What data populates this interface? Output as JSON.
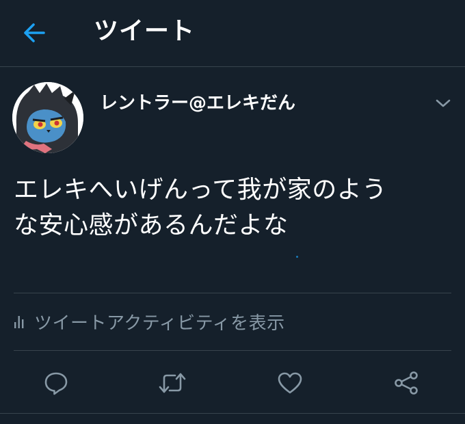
{
  "header": {
    "title": "ツイート",
    "back_icon": "arrow-left-icon"
  },
  "tweet": {
    "display_name": "レントラー@エレキだん",
    "text": "エレキへいげんって我が家のよう\nな安心感があるんだよな",
    "avatar_icon": "luxray-avatar",
    "menu_icon": "chevron-down-icon"
  },
  "activity": {
    "label": "ツイートアクティビティを表示",
    "icon": "bar-chart-icon"
  },
  "actions": [
    {
      "name": "reply",
      "icon": "speech-bubble-icon"
    },
    {
      "name": "retweet",
      "icon": "retweet-icon"
    },
    {
      "name": "like",
      "icon": "heart-icon"
    },
    {
      "name": "share",
      "icon": "share-icon"
    }
  ],
  "colors": {
    "background": "#15202b",
    "accent": "#1da1f2",
    "secondary_text": "#8899a6",
    "divider": "#38444d"
  }
}
